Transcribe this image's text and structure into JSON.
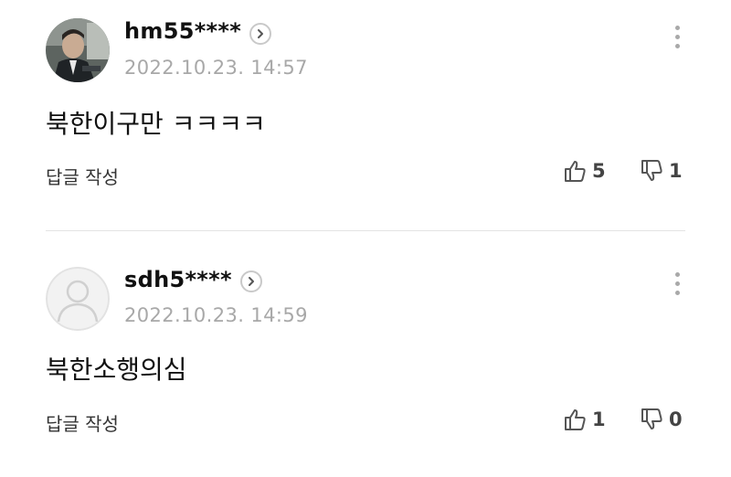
{
  "comments": [
    {
      "nickname": "hm55****",
      "date": "2022.10.23. 14:57",
      "text": "북한이구만 ㅋㅋㅋㅋ",
      "reply_label": "답글 작성",
      "likes": "5",
      "dislikes": "1",
      "avatar": "photo"
    },
    {
      "nickname": "sdh5****",
      "date": "2022.10.23. 14:59",
      "text": "북한소행의심",
      "reply_label": "답글 작성",
      "likes": "1",
      "dislikes": "0",
      "avatar": "default-silhouette"
    }
  ]
}
